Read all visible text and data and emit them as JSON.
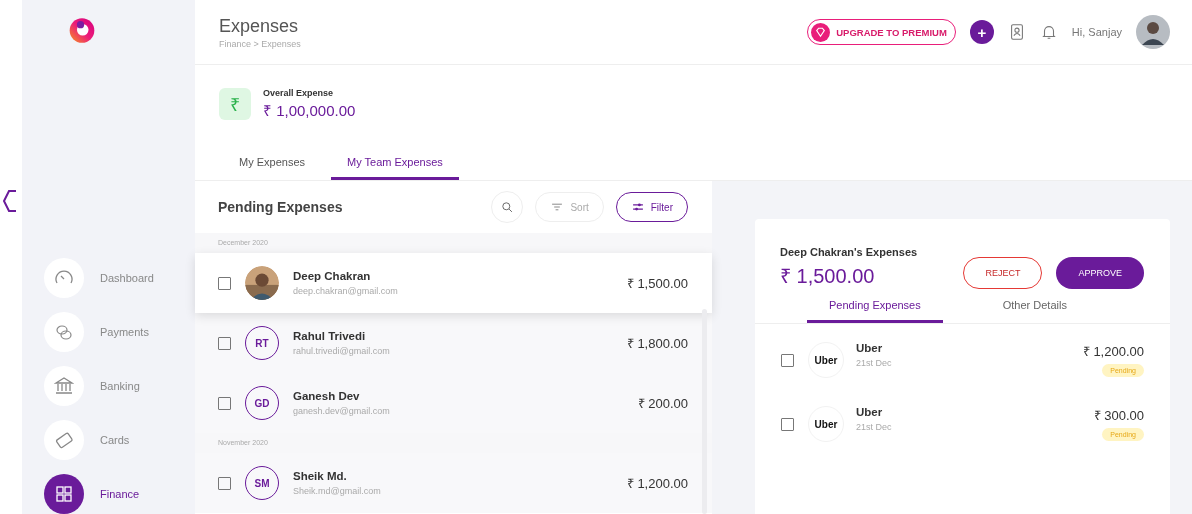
{
  "header": {
    "title": "Expenses",
    "breadcrumb": "Finance > Expenses",
    "upgrade_button": "UPGRADE TO PREMIUM",
    "add_button": "+",
    "greeting": "Hi, Sanjay"
  },
  "sidebar": {
    "items": [
      {
        "label": "Dashboard",
        "selected": false
      },
      {
        "label": "Payments",
        "selected": false
      },
      {
        "label": "Banking",
        "selected": false
      },
      {
        "label": "Cards",
        "selected": false
      },
      {
        "label": "Finance",
        "selected": true
      }
    ]
  },
  "summary": {
    "label": "Overall Expense",
    "amount": "₹ 1,00,000.00",
    "icon": "₹"
  },
  "tabs": [
    {
      "label": "My Expenses",
      "selected": false
    },
    {
      "label": "My Team Expenses",
      "selected": true
    }
  ],
  "pending": {
    "title": "Pending Expenses",
    "sort": "Sort",
    "filter": "Filter",
    "groups": [
      {
        "label": "December 2020",
        "rows": [
          {
            "name": "Deep Chakran",
            "email": "deep.chakran@gmail.com",
            "amount": "₹ 1,500.00",
            "checked": false,
            "selected": true
          },
          {
            "kind": "initials",
            "initials": "RT",
            "name": "Rahul Trivedi",
            "email": "rahul.trivedi@gmail.com",
            "amount": "₹ 1,800.00",
            "checked": false,
            "selected": false
          },
          {
            "kind": "initials",
            "initials": "GD",
            "name": "Ganesh Dev",
            "email": "ganesh.dev@gmail.com",
            "amount": "₹ 200.00",
            "checked": false,
            "selected": false
          }
        ]
      },
      {
        "label": "November 2020",
        "rows": [
          {
            "kind": "initials",
            "initials": "SM",
            "name": "Sheik Md.",
            "email": "Sheik.md@gmail.com",
            "amount": "₹ 1,200.00",
            "checked": false,
            "selected": false
          }
        ]
      }
    ]
  },
  "detail": {
    "title": "Deep Chakran's Expenses",
    "amount": "₹ 1,500.00",
    "reject_button": "REJECT",
    "approve_button": "APPROVE",
    "tabs": [
      {
        "label": "Pending Expenses",
        "selected": true
      },
      {
        "label": "Other Details",
        "selected": false
      }
    ],
    "items": [
      {
        "logo": "Uber",
        "name": "Uber",
        "date": "21st Dec",
        "amount": "₹ 1,200.00",
        "status": "Pending",
        "checked": false
      },
      {
        "logo": "Uber",
        "name": "Uber",
        "date": "21st Dec",
        "amount": "₹ 300.00",
        "status": "Pending",
        "checked": false
      }
    ]
  }
}
